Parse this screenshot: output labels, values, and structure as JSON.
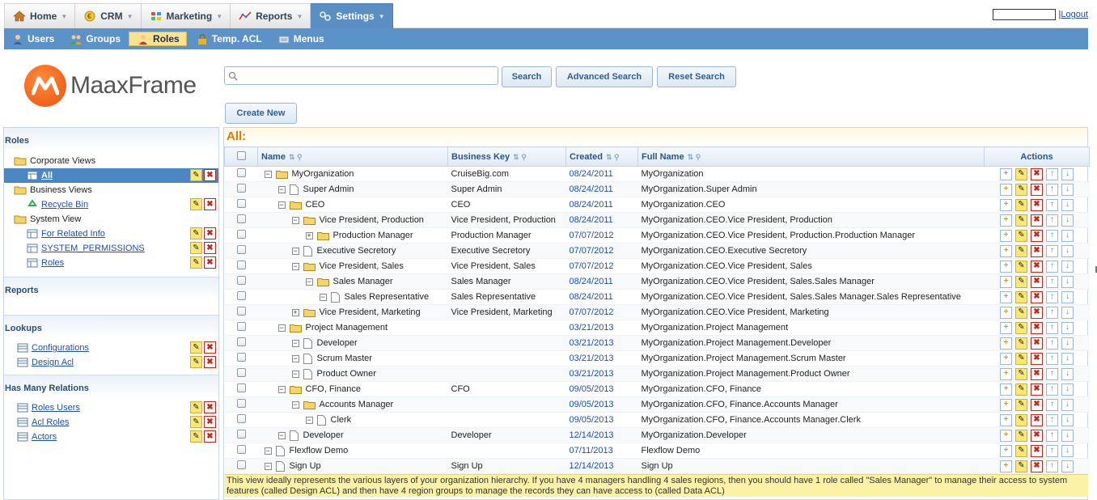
{
  "topmenu": {
    "items": [
      {
        "label": "Home",
        "icon": "home-icon"
      },
      {
        "label": "CRM",
        "icon": "crm-icon"
      },
      {
        "label": "Marketing",
        "icon": "marketing-icon"
      },
      {
        "label": "Reports",
        "icon": "reports-icon"
      },
      {
        "label": "Settings",
        "icon": "settings-icon",
        "active": true
      }
    ],
    "logout": "Logout",
    "separator": "|"
  },
  "submenu": {
    "items": [
      {
        "label": "Users",
        "icon": "users-icon"
      },
      {
        "label": "Groups",
        "icon": "groups-icon"
      },
      {
        "label": "Roles",
        "icon": "roles-icon",
        "active": true
      },
      {
        "label": "Temp. ACL",
        "icon": "lock-icon"
      },
      {
        "label": "Menus",
        "icon": "menus-icon"
      }
    ]
  },
  "logo": {
    "text": "MaaxFrame",
    "color": "#f06a1c"
  },
  "search": {
    "value": "",
    "search_label": "Search",
    "advanced_label": "Advanced Search",
    "reset_label": "Reset Search",
    "create_label": "Create New"
  },
  "left": {
    "roles_title": "Roles",
    "corporate_views": "Corporate Views",
    "all": "All",
    "business_views": "Business Views",
    "recycle_bin": "Recycle Bin",
    "system_view": "System View",
    "for_related_info": "For Related Info",
    "system_permissions": "SYSTEM_PERMISSIONS",
    "roles_link": "Roles",
    "reports_title": "Reports",
    "lookups_title": "Lookups",
    "configurations": "Configurations",
    "design_acl": "Design Acl",
    "has_many_title": "Has Many Relations",
    "roles_users": "Roles Users",
    "acl_roles": "Acl Roles",
    "actors": "Actors"
  },
  "grid": {
    "title": "All:",
    "columns": {
      "name": "Name",
      "business_key": "Business Key",
      "created": "Created",
      "full_name": "Full Name",
      "actions": "Actions"
    },
    "rows": [
      {
        "name": "MyOrganization",
        "business_key": "CruiseBig.com",
        "created": "08/24/2011",
        "full_name": "MyOrganization",
        "depth": 0,
        "type": "folder",
        "toggle": "⊟"
      },
      {
        "name": "Super Admin",
        "business_key": "Super Admin",
        "created": "08/24/2011",
        "full_name": "MyOrganization.Super Admin",
        "depth": 1,
        "type": "doc",
        "toggle": "⊟"
      },
      {
        "name": "CEO",
        "business_key": "CEO",
        "created": "08/24/2011",
        "full_name": "MyOrganization.CEO",
        "depth": 1,
        "type": "folder",
        "toggle": "⊟"
      },
      {
        "name": "Vice President, Production",
        "business_key": "Vice President, Production",
        "created": "08/24/2011",
        "full_name": "MyOrganization.CEO.Vice President, Production",
        "depth": 2,
        "type": "folder",
        "toggle": "⊟"
      },
      {
        "name": "Production Manager",
        "business_key": "Production Manager",
        "created": "07/07/2012",
        "full_name": "MyOrganization.CEO.Vice President, Production.Production Manager",
        "depth": 3,
        "type": "folder",
        "toggle": "⊞"
      },
      {
        "name": "Executive Secretory",
        "business_key": "Executive Secretory",
        "created": "07/07/2012",
        "full_name": "MyOrganization.CEO.Executive Secretory",
        "depth": 2,
        "type": "doc",
        "toggle": "⊟"
      },
      {
        "name": "Vice President, Sales",
        "business_key": "Vice President, Sales",
        "created": "07/07/2012",
        "full_name": "MyOrganization.CEO.Vice President, Sales",
        "depth": 2,
        "type": "folder",
        "toggle": "⊟"
      },
      {
        "name": "Sales Manager",
        "business_key": "Sales Manager",
        "created": "08/24/2011",
        "full_name": "MyOrganization.CEO.Vice President, Sales.Sales Manager",
        "depth": 3,
        "type": "folder",
        "toggle": "⊟"
      },
      {
        "name": "Sales Representative",
        "business_key": "Sales Representative",
        "created": "08/24/2011",
        "full_name": "MyOrganization.CEO.Vice President, Sales.Sales Manager.Sales Representative",
        "depth": 4,
        "type": "doc",
        "toggle": "⊟"
      },
      {
        "name": "Vice President, Marketing",
        "business_key": "Vice President, Marketing",
        "created": "07/07/2012",
        "full_name": "MyOrganization.CEO.Vice President, Marketing",
        "depth": 2,
        "type": "folder",
        "toggle": "⊞"
      },
      {
        "name": "Project Management",
        "business_key": "",
        "created": "03/21/2013",
        "full_name": "MyOrganization.Project Management",
        "depth": 1,
        "type": "folder",
        "toggle": "⊟"
      },
      {
        "name": "Developer",
        "business_key": "",
        "created": "03/21/2013",
        "full_name": "MyOrganization.Project Management.Developer",
        "depth": 2,
        "type": "doc",
        "toggle": "⊟"
      },
      {
        "name": "Scrum Master",
        "business_key": "",
        "created": "03/21/2013",
        "full_name": "MyOrganization.Project Management.Scrum Master",
        "depth": 2,
        "type": "doc",
        "toggle": "⊟"
      },
      {
        "name": "Product Owner",
        "business_key": "",
        "created": "03/21/2013",
        "full_name": "MyOrganization.Project Management.Product Owner",
        "depth": 2,
        "type": "doc",
        "toggle": "⊟"
      },
      {
        "name": "CFO, Finance",
        "business_key": "CFO",
        "created": "09/05/2013",
        "full_name": "MyOrganization.CFO, Finance",
        "depth": 1,
        "type": "folder",
        "toggle": "⊟"
      },
      {
        "name": "Accounts Manager",
        "business_key": "",
        "created": "09/05/2013",
        "full_name": "MyOrganization.CFO, Finance.Accounts Manager",
        "depth": 2,
        "type": "folder",
        "toggle": "⊟"
      },
      {
        "name": "Clerk",
        "business_key": "",
        "created": "09/05/2013",
        "full_name": "MyOrganization.CFO, Finance.Accounts Manager.Clerk",
        "depth": 3,
        "type": "doc",
        "toggle": "⊟"
      },
      {
        "name": "Developer",
        "business_key": "Developer",
        "created": "12/14/2013",
        "full_name": "MyOrganization.Developer",
        "depth": 1,
        "type": "doc",
        "toggle": "⊟"
      },
      {
        "name": "Flexflow Demo",
        "business_key": "",
        "created": "07/11/2013",
        "full_name": "Flexflow Demo",
        "depth": 0,
        "type": "doc",
        "toggle": "⊟"
      },
      {
        "name": "Sign Up",
        "business_key": "Sign Up",
        "created": "12/14/2013",
        "full_name": "Sign Up",
        "depth": 0,
        "type": "doc",
        "toggle": "⊟"
      }
    ]
  },
  "note": "This view ideally represents the various layers of your organization hierarchy. If you have 4 managers handling 4 sales regions, then you should have 1 role called \"Sales Manager\" to manage their access to system features (called Design ACL) and then have 4 region groups to manage the records they can have access to (called Data ACL)",
  "colors": {
    "accent": "#5b93c9",
    "highlight": "#fbe28f",
    "title": "#e07b00",
    "link": "#1f4fa8"
  }
}
